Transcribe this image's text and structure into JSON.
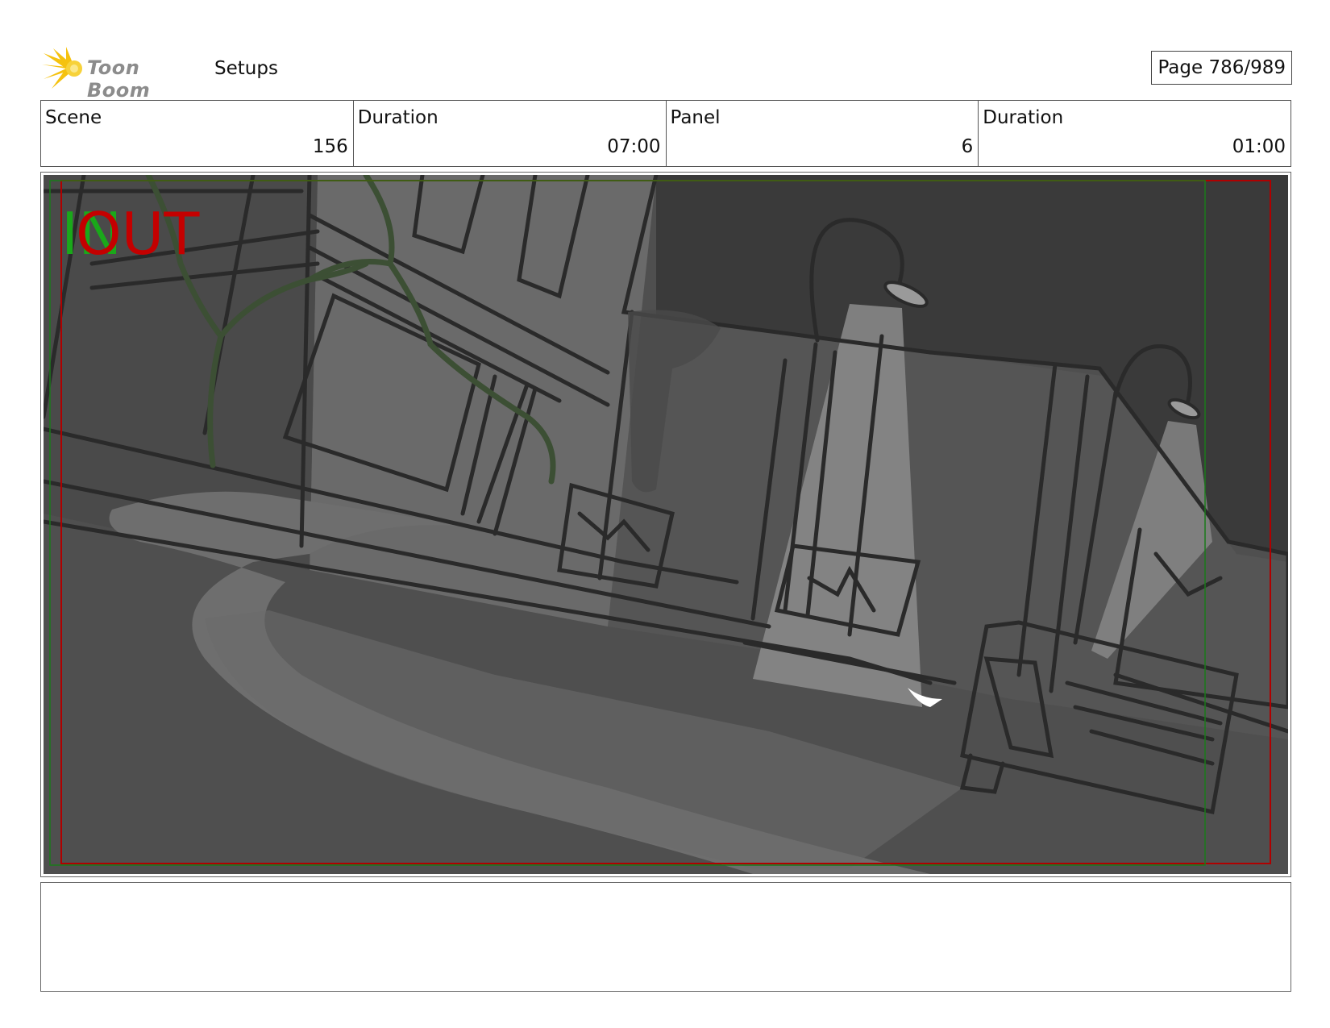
{
  "header": {
    "logo_text": "Toon Boom",
    "section_title": "Setups",
    "page_label": "Page 786/989"
  },
  "info": {
    "scene_label": "Scene",
    "scene_value": "156",
    "scene_duration_label": "Duration",
    "scene_duration_value": "07:00",
    "panel_label": "Panel",
    "panel_value": "6",
    "panel_duration_label": "Duration",
    "panel_duration_value": "01:00"
  },
  "panel_image": {
    "in_marker": "IN",
    "out_marker": "OUT"
  },
  "notes": {
    "text": ""
  },
  "colors": {
    "in_marker": "#1aa81a",
    "out_marker": "#c40000",
    "safe_frame": "#c40000",
    "title_frame": "#1a7a1a"
  }
}
